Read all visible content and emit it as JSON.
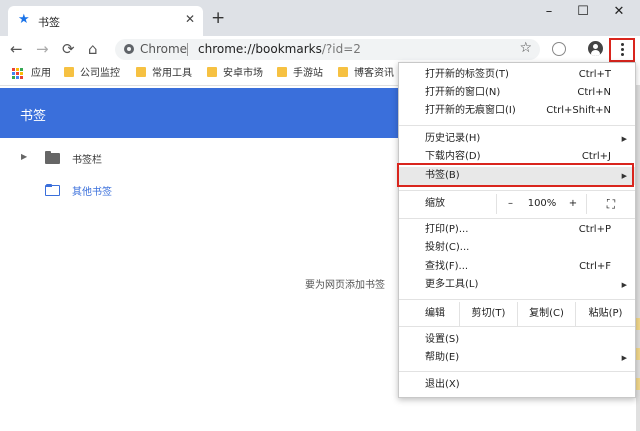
{
  "tab": {
    "title": "书签",
    "close": "✕",
    "new_tab": "+"
  },
  "window": {
    "minimize": "–",
    "maximize": "☐",
    "close": "✕"
  },
  "toolbar": {
    "back": "←",
    "forward": "→",
    "reload": "⟳",
    "home": "⌂",
    "scheme": "Chrome",
    "url_host": "chrome://bookmarks",
    "url_rest": "/?id=2",
    "star": "☆"
  },
  "bookmarks_bar": {
    "apps_label": "应用",
    "items": [
      "公司监控",
      "常用工具",
      "安卓市场",
      "手游站",
      "博客资讯"
    ]
  },
  "page": {
    "title": "书签",
    "tree": [
      {
        "label": "书签栏",
        "selected": false
      },
      {
        "label": "其他书签",
        "selected": true
      }
    ],
    "empty_message": "要为网页添加书签"
  },
  "menu": {
    "items": {
      "new_tab": {
        "label": "打开新的标签页(T)",
        "shortcut": "Ctrl+T"
      },
      "new_window": {
        "label": "打开新的窗口(N)",
        "shortcut": "Ctrl+N"
      },
      "incognito": {
        "label": "打开新的无痕窗口(I)",
        "shortcut": "Ctrl+Shift+N"
      },
      "history": {
        "label": "历史记录(H)"
      },
      "downloads": {
        "label": "下载内容(D)",
        "shortcut": "Ctrl+J"
      },
      "bookmarks": {
        "label": "书签(B)"
      },
      "print": {
        "label": "打印(P)...",
        "shortcut": "Ctrl+P"
      },
      "cast": {
        "label": "投射(C)..."
      },
      "find": {
        "label": "查找(F)...",
        "shortcut": "Ctrl+F"
      },
      "more_tools": {
        "label": "更多工具(L)"
      },
      "settings": {
        "label": "设置(S)"
      },
      "help": {
        "label": "帮助(E)"
      },
      "exit": {
        "label": "退出(X)"
      }
    },
    "zoom": {
      "label": "缩放",
      "minus": "–",
      "value": "100%",
      "plus": "+",
      "fullscreen": "⛶"
    },
    "edit": {
      "label": "编辑",
      "cut": "剪切(T)",
      "copy": "复制(C)",
      "paste": "粘贴(P)"
    },
    "submenu_arrow": "▶"
  },
  "colors": {
    "accent": "#3a6fdb",
    "highlight_box": "#d9251d",
    "folder": "#f6c142"
  }
}
